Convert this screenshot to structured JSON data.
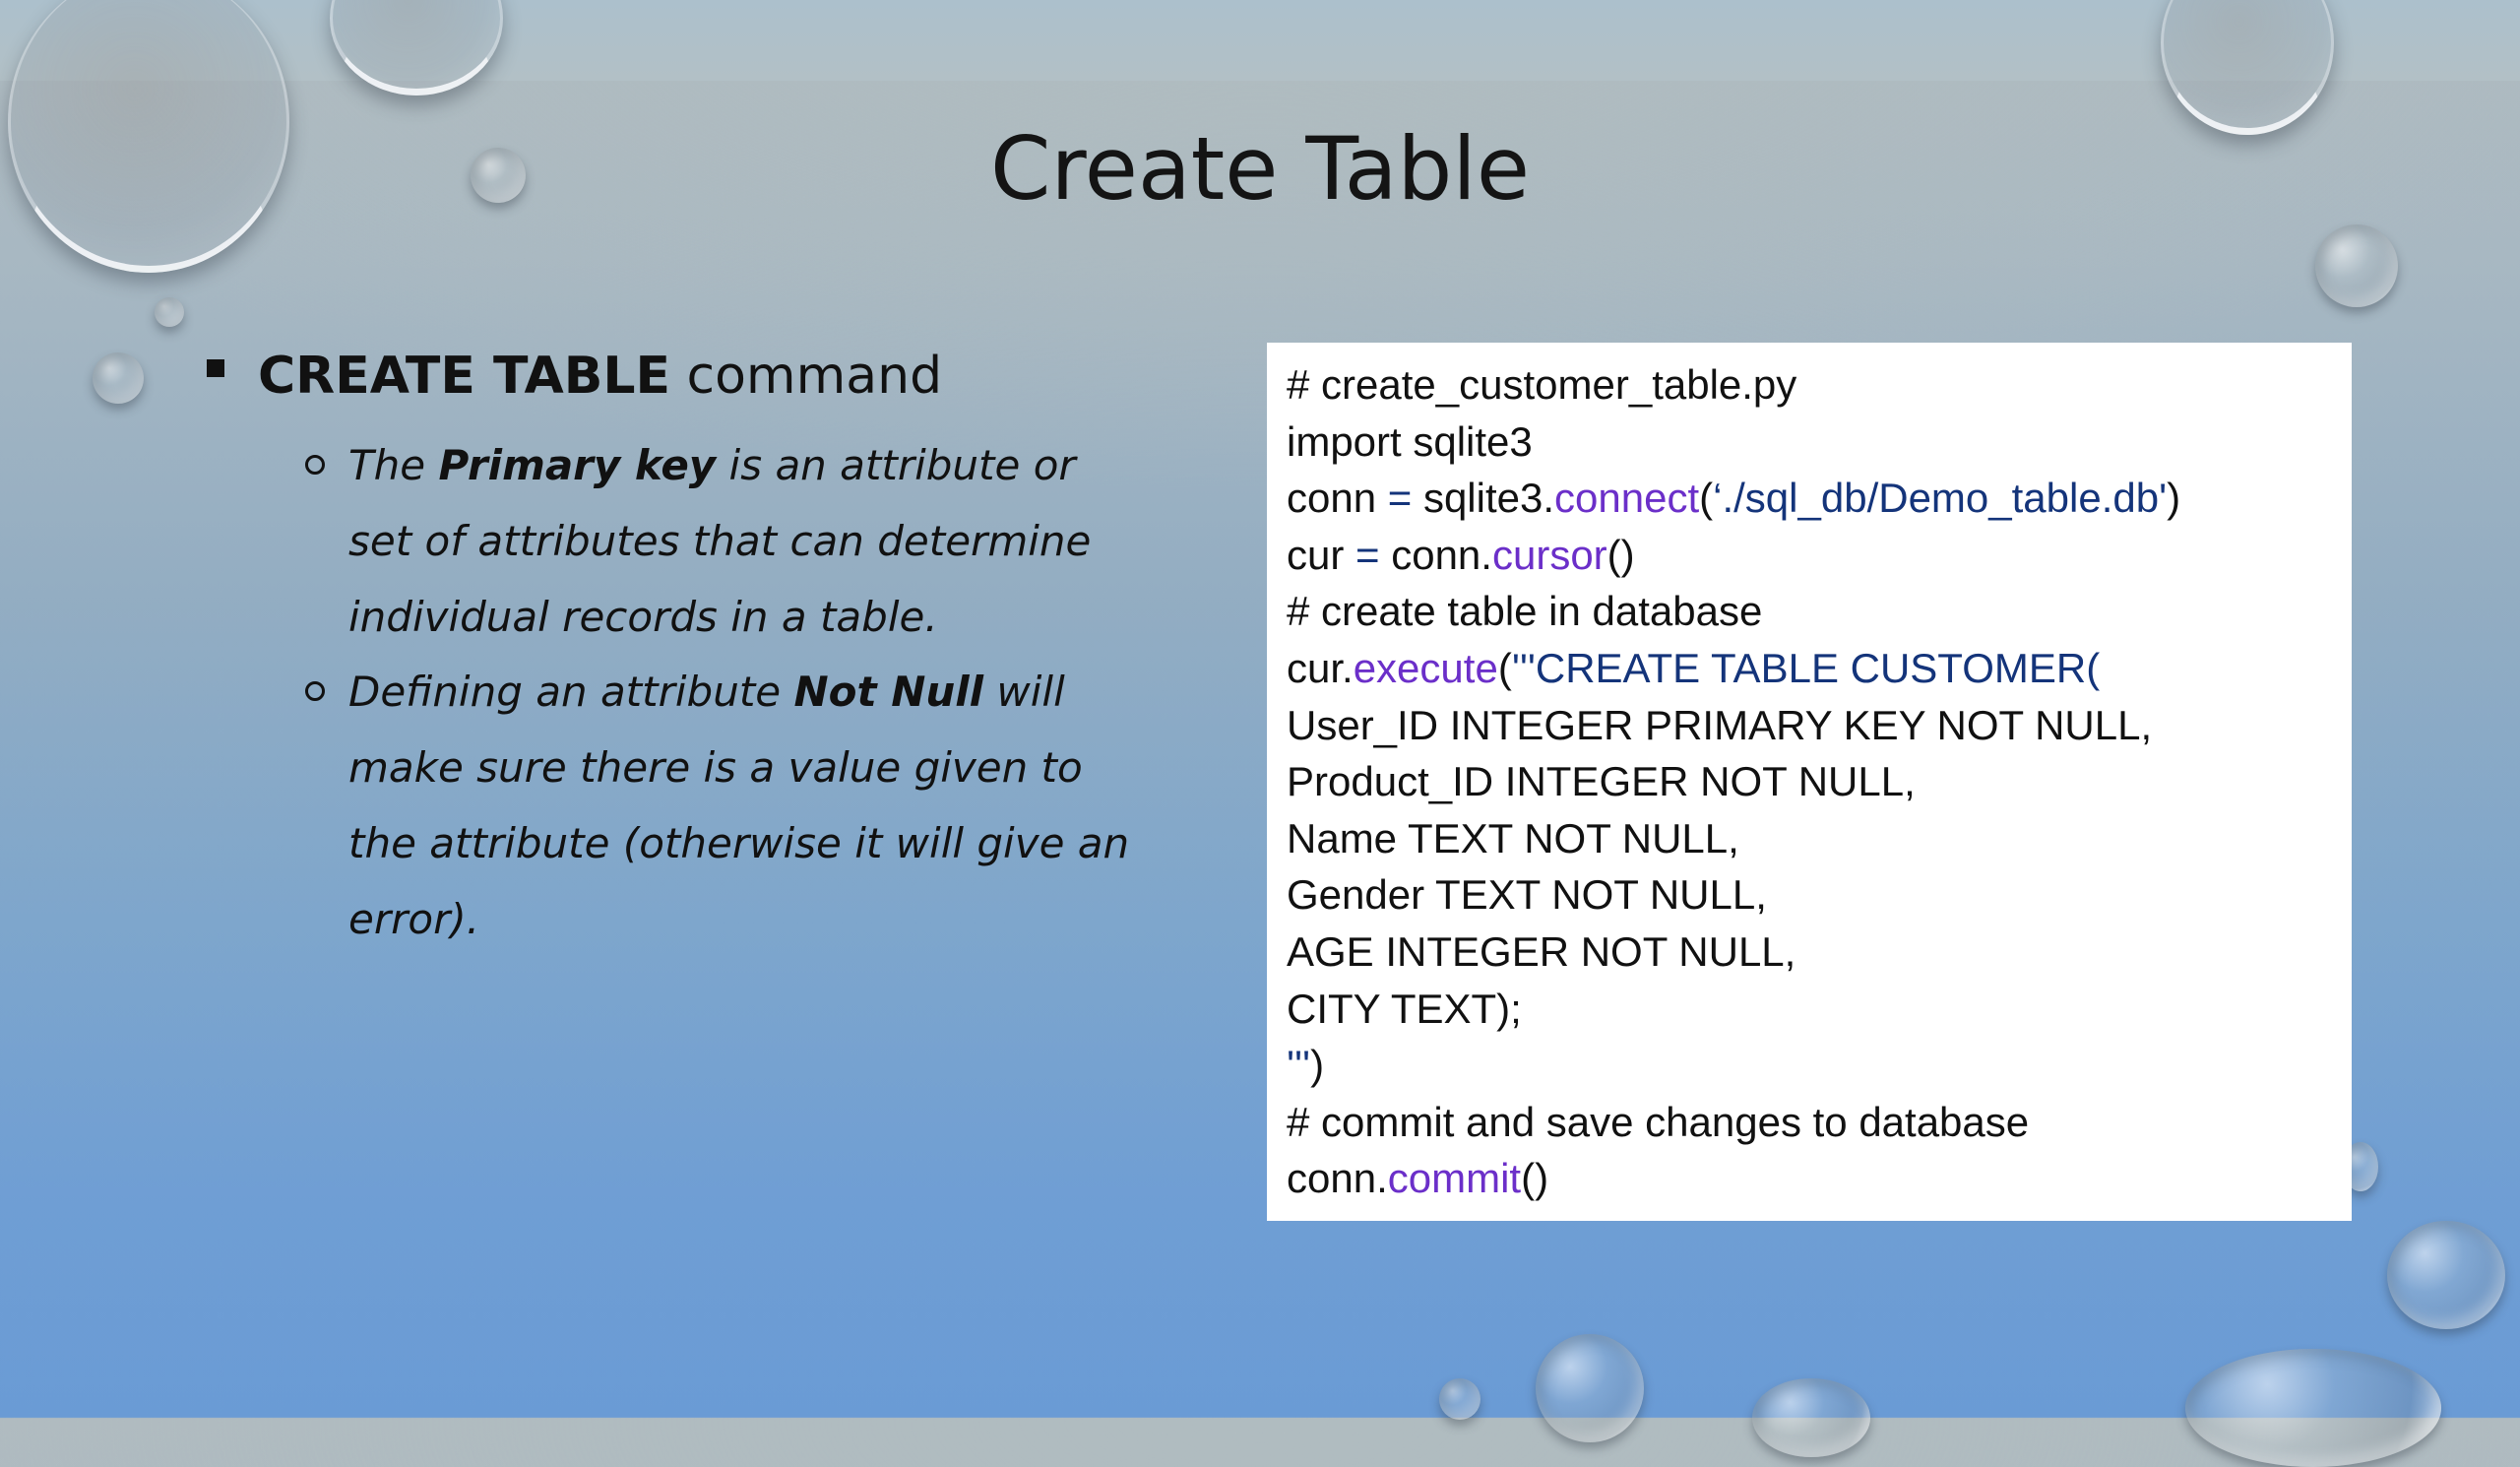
{
  "slide": {
    "title": "Create Table",
    "bullet": {
      "bold": "CREATE TABLE",
      "rest": " command"
    },
    "sub_bullets": [
      {
        "t1": "The ",
        "b1": "Primary key",
        "t2": " is an attribute or set of attributes that can determine individual records in a table."
      },
      {
        "t1": "Defining an attribute ",
        "b1": "Not Null",
        "t2": " will make sure there is a value given to the attribute (otherwise it will give an error)."
      }
    ]
  },
  "code": {
    "l1": "# create_customer_table.py",
    "l2": "import sqlite3",
    "l3": {
      "a": "conn ",
      "b": "=",
      "c": " sqlite3.",
      "d": "connect",
      "e": "(",
      "f": "‘./sql_db/Demo_table.db'",
      "g": ")"
    },
    "l4": {
      "a": "cur ",
      "b": "=",
      "c": " conn.",
      "d": "cursor",
      "e": "()"
    },
    "l5": "# create table in database",
    "l6": {
      "a": "cur.",
      "b": "execute",
      "c": "(",
      "d": "'''CREATE TABLE CUSTOMER("
    },
    "l7": "User_ID INTEGER PRIMARY KEY NOT NULL,",
    "l8": "Product_ID INTEGER NOT NULL,",
    "l9": "Name TEXT NOT NULL,",
    "l10": "Gender TEXT NOT NULL,",
    "l11": "AGE INTEGER NOT NULL,",
    "l12": "CITY TEXT);",
    "l13": {
      "a": "'''",
      "b": ")"
    },
    "l14": "# commit and save changes to database",
    "l15": {
      "a": "conn.",
      "b": "commit",
      "c": "()"
    }
  },
  "colors": {
    "code_string": "#14347a",
    "code_method": "#6b2fc9",
    "code_comment": "#7a7a7a"
  }
}
